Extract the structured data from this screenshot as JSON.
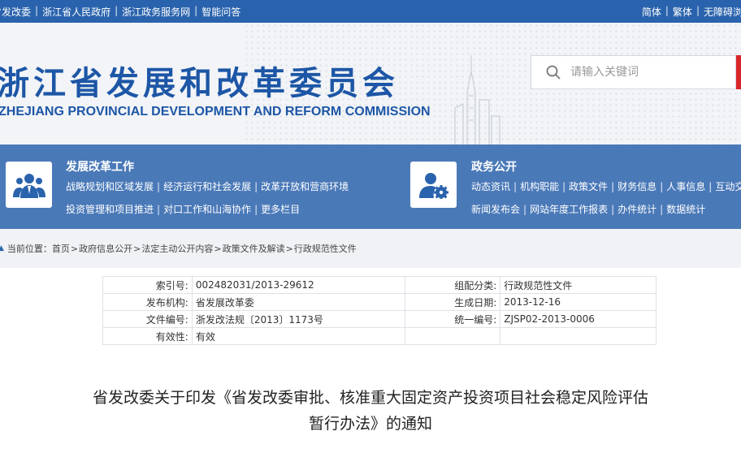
{
  "topbar": {
    "left_links": [
      "省发改委",
      "浙江省人民政府",
      "浙江政务服务网",
      "智能问答"
    ],
    "right_links": [
      "简体",
      "繁体",
      "无障碍浏览"
    ]
  },
  "header": {
    "title_cn": "浙江省发展和改革委员会",
    "title_en": "ZHEJIANG PROVINCIAL DEVELOPMENT AND REFORM COMMISSION",
    "search_placeholder": "请输入关键词"
  },
  "nav": {
    "work": {
      "title": "发展改革工作",
      "row1": [
        "战略规划和区域发展",
        "经济运行和社会发展",
        "改革开放和营商环境"
      ],
      "row2": [
        "投资管理和项目推进",
        "对口工作和山海协作",
        "更多栏目"
      ]
    },
    "public": {
      "title": "政务公开",
      "row1": [
        "动态资讯",
        "机构职能",
        "政策文件",
        "财务信息",
        "人事信息",
        "互动交流"
      ],
      "row2": [
        "新闻发布会",
        "网站年度工作报表",
        "办件统计",
        "数据统计"
      ]
    }
  },
  "breadcrumb": {
    "prefix": "当前位置：",
    "items": [
      "首页",
      "政府信息公开",
      "法定主动公开内容",
      "政策文件及解读",
      "行政规范性文件"
    ]
  },
  "meta": {
    "rows": [
      {
        "k1": "索引号:",
        "v1": "002482031/2013-29612",
        "k2": "组配分类:",
        "v2": "行政规范性文件"
      },
      {
        "k1": "发布机构:",
        "v1": "省发展改革委",
        "k2": "生成日期:",
        "v2": "2013-12-16"
      },
      {
        "k1": "文件编号:",
        "v1": "浙发改法规〔2013〕1173号",
        "k2": "统一编号:",
        "v2": "ZJSP02-2013-0006"
      },
      {
        "k1": "有效性:",
        "v1": "有效",
        "k2": "",
        "v2": ""
      }
    ]
  },
  "document": {
    "title_line1": "省发改委关于印发《省发改委审批、核准重大固定资产投资项目社会稳定风险评估",
    "title_line2": "暂行办法》的通知"
  },
  "colors": {
    "topbar": "#2a63ad",
    "navband": "#4a79b8",
    "title_blue": "#1d56a6",
    "search_accent": "#d9262b"
  }
}
